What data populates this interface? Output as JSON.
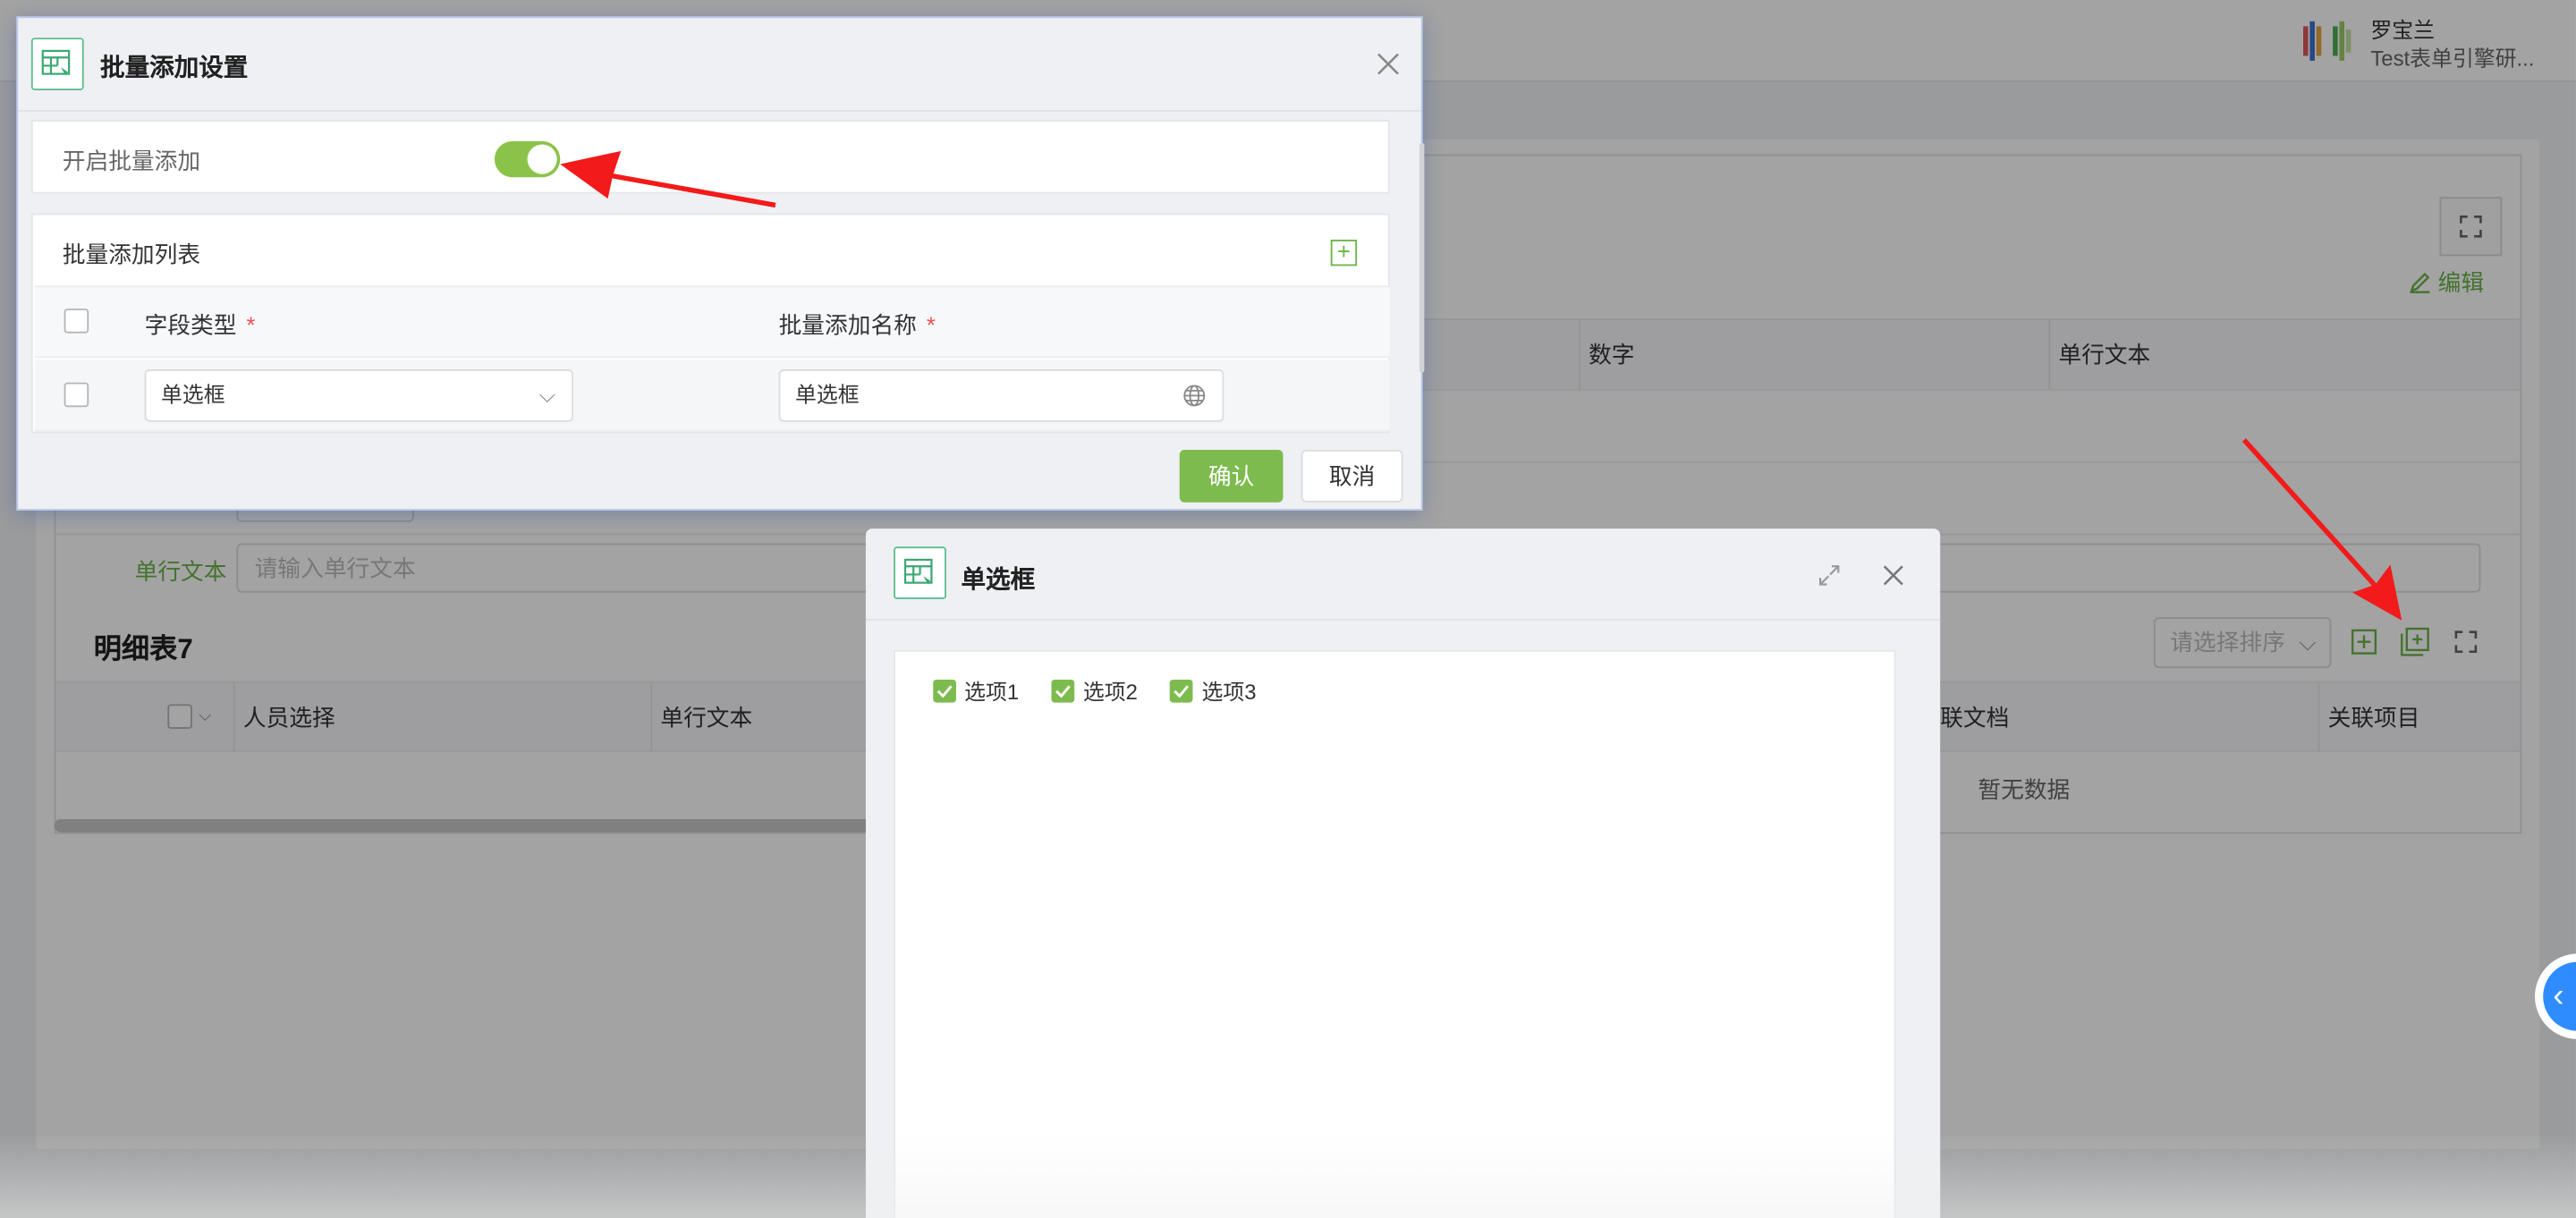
{
  "user": {
    "name": "罗宝兰",
    "org": "Test表单引擎研..."
  },
  "background": {
    "edit_label": "编辑",
    "table_columns": [
      "数字",
      "单行文本"
    ],
    "form_field_label": "单行文本",
    "form_field_placeholder": "请输入单行文本",
    "detail_title": "明细表7",
    "sort_placeholder": "请选择排序",
    "detail_columns": [
      "人员选择",
      "单行文本",
      "联文档",
      "关联项目"
    ],
    "empty_text": "暂无数据"
  },
  "batch_dialog": {
    "title": "批量添加设置",
    "toggle_label": "开启批量添加",
    "toggle_on": true,
    "list_title": "批量添加列表",
    "col_field_type": "字段类型",
    "col_batch_name": "批量添加名称",
    "required_mark": "*",
    "row": {
      "field_type": "单选框",
      "batch_name": "单选框"
    },
    "confirm_label": "确认",
    "cancel_label": "取消"
  },
  "radio_dialog": {
    "title": "单选框",
    "options": [
      {
        "label": "选项1",
        "checked": true
      },
      {
        "label": "选项2",
        "checked": true
      },
      {
        "label": "选项3",
        "checked": true
      }
    ]
  },
  "colors": {
    "accent_green": "#7dbb4f",
    "toggle_green": "#8bc34a",
    "annotation_red": "#f21a1a",
    "fab_blue": "#2f8cff"
  },
  "icons": {
    "dialog_icon": "form-grid-icon",
    "close": "close-icon",
    "expand": "expand-icon",
    "add": "add-square-icon",
    "batch_add": "batch-add-icon",
    "fullscreen": "fullscreen-icon",
    "globe": "globe-icon",
    "chevron": "chevron-down-icon"
  }
}
